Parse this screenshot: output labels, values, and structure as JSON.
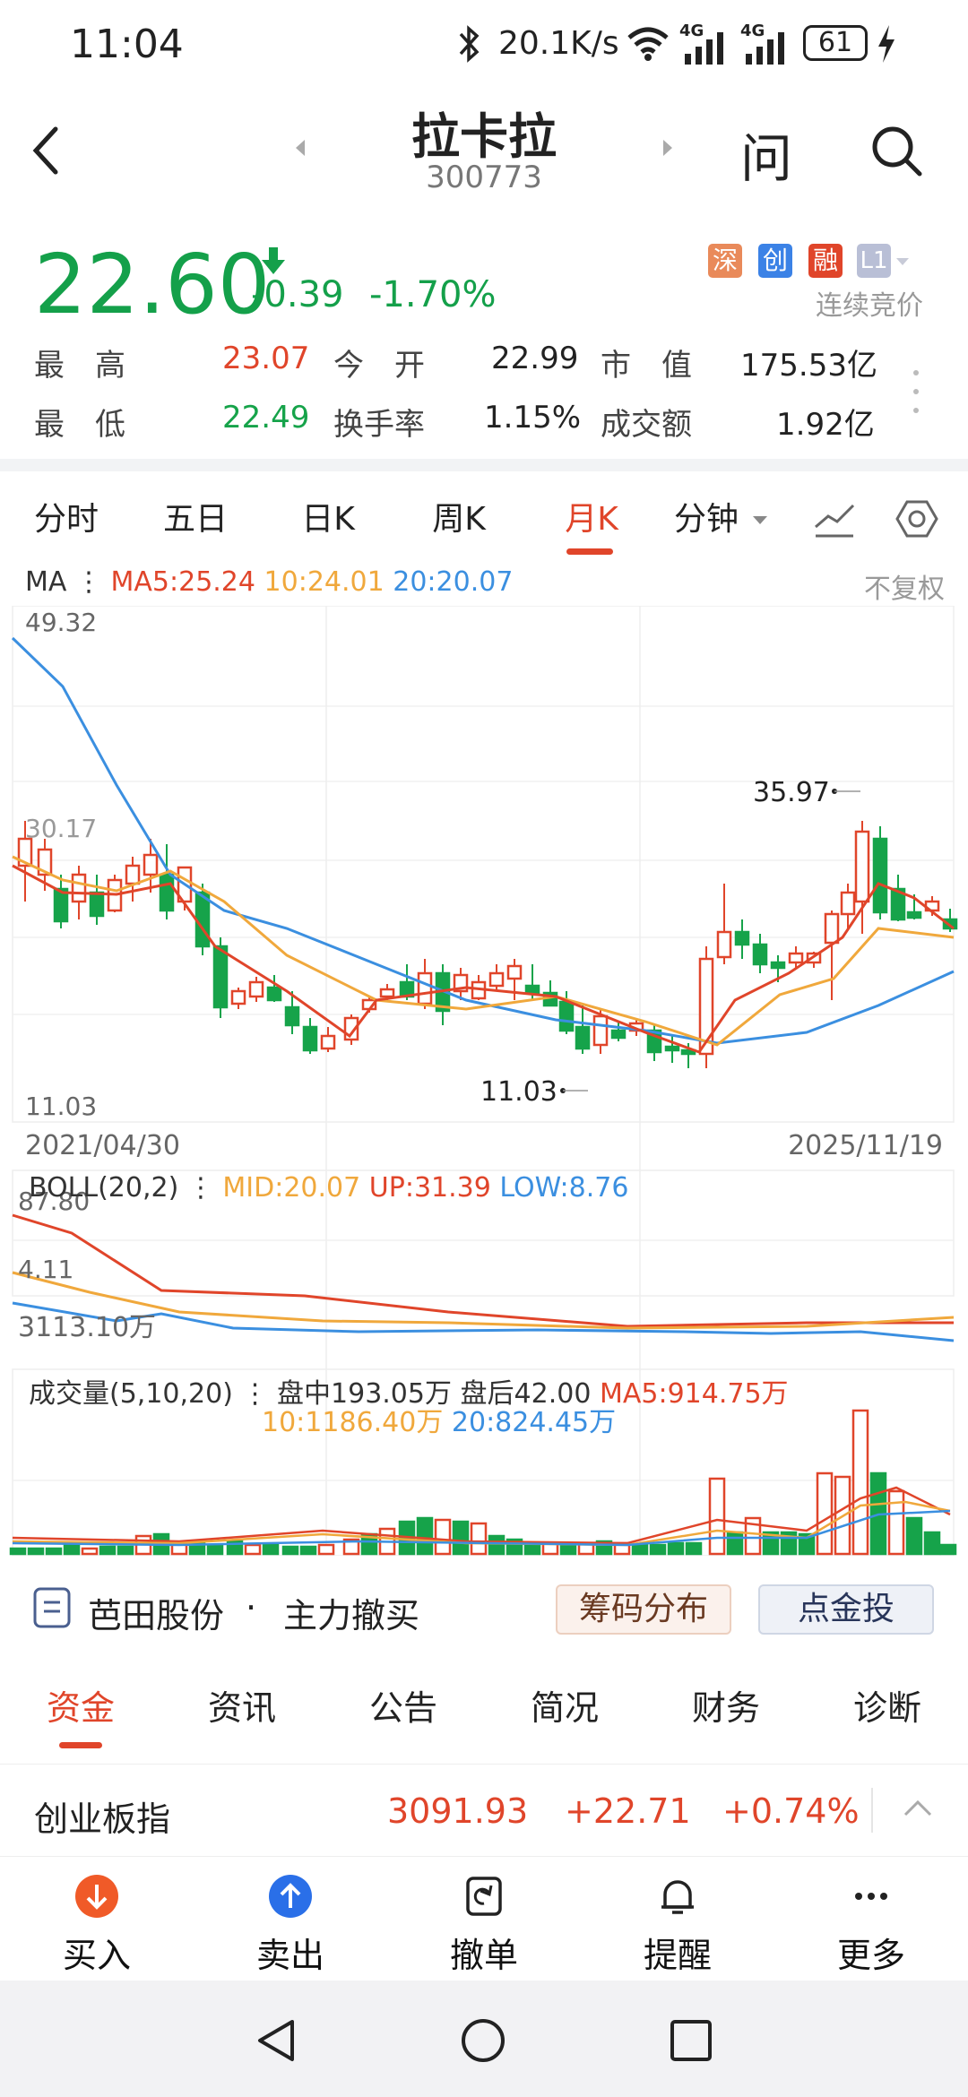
{
  "status": {
    "time": "11:04",
    "speed": "20.1K/s",
    "battery": "61",
    "net1": "4G",
    "net2": "4G"
  },
  "header": {
    "name": "拉卡拉",
    "code": "300773",
    "ask_label": "问"
  },
  "quote": {
    "price": "22.60",
    "change": "-0.39",
    "change_pct": "-1.70%",
    "badges": [
      "深",
      "创",
      "融",
      "L1"
    ],
    "auction_label": "连续竞价",
    "rows": [
      [
        {
          "label": "最　高",
          "value": "23.07",
          "color": "red"
        },
        {
          "label": "今　开",
          "value": "22.99",
          "color": "plain"
        },
        {
          "label": "市　值",
          "value": "175.53亿",
          "color": "plain"
        }
      ],
      [
        {
          "label": "最　低",
          "value": "22.49",
          "color": "green"
        },
        {
          "label": "换手率",
          "value": "1.15%",
          "color": "plain"
        },
        {
          "label": "成交额",
          "value": "1.92亿",
          "color": "plain"
        }
      ]
    ]
  },
  "chart_tabs": {
    "items": [
      "分时",
      "五日",
      "日K",
      "周K",
      "月K",
      "分钟"
    ],
    "active": "月K"
  },
  "ma": {
    "label": "MA",
    "ma5": "MA5:25.24",
    "ma10": "10:24.01",
    "ma20": "20:20.07",
    "adjust": "不复权"
  },
  "kline": {
    "ymax": "49.32",
    "ymin": "11.03",
    "mid_label": "30.17",
    "high_label": "35.97",
    "low_label": "11.03",
    "start_date": "2021/04/30",
    "end_date": "2025/11/19"
  },
  "boll": {
    "label": "BOLL(20,2)",
    "mid": "MID:20.07",
    "up": "UP:31.39",
    "low": "LOW:8.76",
    "ymax": "87.80",
    "ymin": "4.11"
  },
  "volume": {
    "label": "成交量(5,10,20)",
    "intraday": "盘中193.05万",
    "after": "盘后42.00",
    "ma5": "MA5:914.75万",
    "ma10": "10:1186.40万",
    "ma20": "20:824.45万",
    "ymax": "3113.10万"
  },
  "info_bar": {
    "stock": "芭田股份",
    "event": "主力撤买",
    "chips_btn": "筹码分布",
    "gold_btn": "点金投"
  },
  "sub_tabs": {
    "items": [
      "资金",
      "资讯",
      "公告",
      "简况",
      "财务",
      "诊断"
    ],
    "active": "资金"
  },
  "index": {
    "name": "创业板指",
    "value": "3091.93",
    "change": "+22.71",
    "pct": "+0.74%"
  },
  "actions": {
    "buy": "买入",
    "sell": "卖出",
    "cancel": "撤单",
    "alert": "提醒",
    "more": "更多"
  },
  "colors": {
    "up": "#e0452a",
    "down": "#16a34a",
    "ma10": "#f0a83c",
    "ma20": "#3b8fe0"
  }
}
